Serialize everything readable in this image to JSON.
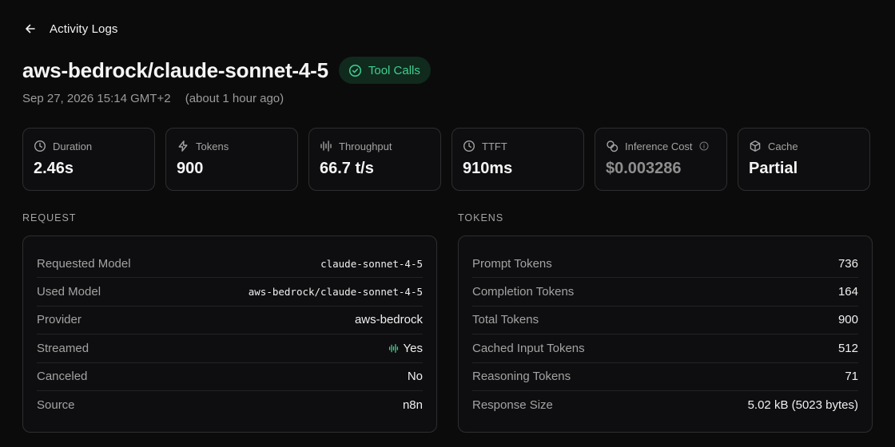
{
  "header": {
    "back_label": "Activity Logs"
  },
  "title": "aws-bedrock/claude-sonnet-4-5",
  "badge": {
    "label": "Tool Calls",
    "color": "#3fcf8e"
  },
  "timestamp": "Sep 27, 2026 15:14 GMT+2",
  "relative_time": "(about 1 hour ago)",
  "stats": [
    {
      "label": "Duration",
      "value": "2.46s",
      "icon": "clock-icon"
    },
    {
      "label": "Tokens",
      "value": "900",
      "icon": "lightning-icon"
    },
    {
      "label": "Throughput",
      "value": "66.7 t/s",
      "icon": "audio-waveform-icon"
    },
    {
      "label": "TTFT",
      "value": "910ms",
      "icon": "clock-icon"
    },
    {
      "label": "Inference Cost",
      "value": "$0.003286",
      "icon": "coins-icon"
    },
    {
      "label": "Cache",
      "value": "Partial",
      "icon": "box-icon"
    }
  ],
  "request": {
    "label": "REQUEST",
    "rows": [
      {
        "key": "Requested Model",
        "value": "claude-sonnet-4-5"
      },
      {
        "key": "Used Model",
        "value": "aws-bedrock/claude-sonnet-4-5"
      },
      {
        "key": "Provider",
        "value": "aws-bedrock"
      },
      {
        "key": "Streamed",
        "value": "Yes"
      },
      {
        "key": "Canceled",
        "value": "No"
      },
      {
        "key": "Source",
        "value": "n8n"
      }
    ]
  },
  "tokens": {
    "label": "TOKENS",
    "rows": [
      {
        "key": "Prompt Tokens",
        "value": "736"
      },
      {
        "key": "Completion Tokens",
        "value": "164"
      },
      {
        "key": "Total Tokens",
        "value": "900"
      },
      {
        "key": "Cached Input Tokens",
        "value": "512"
      },
      {
        "key": "Reasoning Tokens",
        "value": "71"
      },
      {
        "key": "Response Size",
        "value": "5.02 kB (5023 bytes)"
      }
    ]
  }
}
